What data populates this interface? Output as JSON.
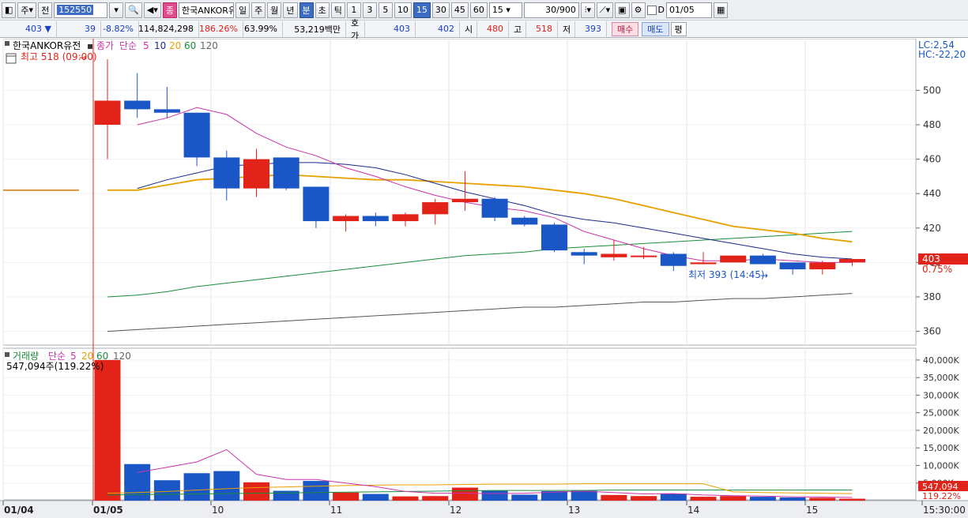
{
  "toolbar": {
    "period_select": "주",
    "prev_label": "전",
    "stock_code": "152550",
    "pink_label": "종",
    "stock_name": "한국ANKOR유",
    "period_buttons": [
      "일",
      "주",
      "월",
      "년"
    ],
    "selected_period": "분",
    "tick_labels": [
      "초",
      "틱"
    ],
    "interval_buttons": [
      "1",
      "3",
      "5",
      "10",
      "15",
      "30",
      "45",
      "60"
    ],
    "selected_interval": "15",
    "interval_select": "15",
    "count_value": "30/900",
    "checkbox_label": "D",
    "date_value": "01/05"
  },
  "quote": {
    "price": "403",
    "direction": "▼",
    "change": "39",
    "change_pct": "-8.82%",
    "volume": "114,824,298",
    "volume_ratio": "186.26%",
    "turnover": "63.99%",
    "amount": "53,219백만",
    "hoga_label": "호가",
    "ask": "403",
    "bid": "402",
    "open_label": "시",
    "open": "480",
    "high_label": "고",
    "high": "518",
    "low_label": "저",
    "low": "393",
    "buy_label": "매수",
    "sell_label": "매도",
    "eval_label": "평"
  },
  "price_panel": {
    "name": "한국ANKOR유전",
    "close_label": "종가",
    "ma_label": "단순",
    "ma_periods": [
      "5",
      "10",
      "20",
      "60",
      "120"
    ],
    "high_annot": "최고 518 (09:00)",
    "low_annot": "최저 393 (14:45)",
    "lc": "LC:2,54",
    "hc": "HC:-22,20",
    "current_price": "403",
    "current_pct": "0.75%"
  },
  "volume_panel": {
    "title": "거래량",
    "ma_label": "단순",
    "ma_periods": [
      "5",
      "20",
      "60",
      "120"
    ],
    "info": "547,094주(119.22%)",
    "current_volume": "547,094",
    "current_pct": "119.22%"
  },
  "colors": {
    "up": "#e2231a",
    "down": "#1b56c6",
    "ma5": "#cc33aa",
    "ma10": "#1a2a8c",
    "ma20": "#e8a000",
    "ma60": "#1a8c3a",
    "ma120": "#555555"
  },
  "chart_data": [
    {
      "type": "candlestick",
      "x_axis_labels": [
        "01/04",
        "01/05",
        "10",
        "11",
        "12",
        "13",
        "14",
        "15",
        "15:30:00"
      ],
      "y_ticks": [
        500,
        480,
        460,
        440,
        420,
        400,
        380,
        360
      ],
      "ylim": [
        352,
        530
      ],
      "prev_close": 442,
      "candles": [
        {
          "o": 480,
          "h": 518,
          "l": 460,
          "c": 494
        },
        {
          "o": 494,
          "h": 510,
          "l": 484,
          "c": 489
        },
        {
          "o": 489,
          "h": 502,
          "l": 484,
          "c": 487
        },
        {
          "o": 487,
          "h": 487,
          "l": 456,
          "c": 461
        },
        {
          "o": 461,
          "h": 465,
          "l": 436,
          "c": 443
        },
        {
          "o": 443,
          "h": 466,
          "l": 438,
          "c": 460
        },
        {
          "o": 461,
          "h": 461,
          "l": 442,
          "c": 443
        },
        {
          "o": 444,
          "h": 444,
          "l": 420,
          "c": 424
        },
        {
          "o": 424,
          "h": 428,
          "l": 418,
          "c": 427
        },
        {
          "o": 427,
          "h": 429,
          "l": 421,
          "c": 424
        },
        {
          "o": 424,
          "h": 429,
          "l": 421,
          "c": 428
        },
        {
          "o": 428,
          "h": 437,
          "l": 422,
          "c": 435
        },
        {
          "o": 435,
          "h": 453,
          "l": 430,
          "c": 437
        },
        {
          "o": 437,
          "h": 438,
          "l": 424,
          "c": 426
        },
        {
          "o": 426,
          "h": 427,
          "l": 421,
          "c": 422
        },
        {
          "o": 422,
          "h": 423,
          "l": 406,
          "c": 407
        },
        {
          "o": 406,
          "h": 408,
          "l": 399,
          "c": 404
        },
        {
          "o": 403,
          "h": 413,
          "l": 401,
          "c": 405
        },
        {
          "o": 404,
          "h": 409,
          "l": 402,
          "c": 404
        },
        {
          "o": 405,
          "h": 406,
          "l": 395,
          "c": 398
        },
        {
          "o": 399,
          "h": 406,
          "l": 399,
          "c": 400
        },
        {
          "o": 400,
          "h": 404,
          "l": 400,
          "c": 404
        },
        {
          "o": 404,
          "h": 405,
          "l": 399,
          "c": 399
        },
        {
          "o": 400,
          "h": 400,
          "l": 393,
          "c": 396
        },
        {
          "o": 396,
          "h": 401,
          "l": 393,
          "c": 400
        },
        {
          "o": 400,
          "h": 401,
          "l": 398,
          "c": 402
        }
      ],
      "ma5": [
        null,
        480,
        484,
        490,
        486,
        475,
        467,
        462,
        455,
        450,
        444,
        439,
        435,
        432,
        430,
        426,
        418,
        413,
        408,
        404,
        401,
        401,
        402,
        401,
        400,
        400
      ],
      "ma10": [
        null,
        443,
        448,
        452,
        456,
        457,
        458,
        458,
        457,
        455,
        451,
        446,
        441,
        437,
        433,
        428,
        425,
        423,
        420,
        417,
        414,
        411,
        408,
        405,
        403,
        402
      ],
      "ma20": [
        442,
        442,
        445,
        448,
        449,
        450,
        451,
        450,
        449,
        448,
        448,
        447,
        446,
        445,
        444,
        442,
        440,
        437,
        433,
        429,
        425,
        421,
        419,
        417,
        414,
        412
      ],
      "ma60": [
        380,
        381,
        383,
        386,
        388,
        390,
        392,
        394,
        396,
        398,
        400,
        402,
        404,
        405,
        406,
        408,
        409,
        410,
        411,
        412,
        413,
        414,
        415,
        416,
        417,
        418
      ],
      "ma120": [
        360,
        361,
        362,
        363,
        364,
        365,
        366,
        367,
        368,
        369,
        370,
        371,
        372,
        373,
        374,
        374,
        375,
        376,
        377,
        377,
        378,
        379,
        379,
        380,
        381,
        382
      ]
    },
    {
      "type": "bar",
      "title": "거래량",
      "y_ticks": [
        "40,000K",
        "35,000K",
        "30,000K",
        "25,000K",
        "20,000K",
        "15,000K",
        "10,000K",
        "5,000K"
      ],
      "ylim": [
        0,
        42000
      ],
      "values": [
        40000,
        10400,
        5800,
        7800,
        8400,
        5200,
        2800,
        5600,
        2300,
        1900,
        1200,
        1300,
        3700,
        2800,
        1700,
        2700,
        2800,
        1600,
        1300,
        2000,
        1100,
        1300,
        1100,
        900,
        800,
        547
      ],
      "ma5": [
        null,
        8000,
        9500,
        11000,
        14500,
        7500,
        6000,
        6000,
        5000,
        4000,
        2600,
        2100,
        2100,
        2000,
        2100,
        2400,
        2700,
        2300,
        1900,
        2000,
        1600,
        1400,
        1300,
        1100,
        1000,
        900
      ],
      "ma20": [
        2100,
        2300,
        2600,
        3000,
        3400,
        3700,
        3900,
        4100,
        4300,
        4400,
        4500,
        4500,
        4600,
        4700,
        4700,
        4700,
        4800,
        4800,
        4800,
        4800,
        4800,
        2500,
        2300,
        2200,
        2100,
        2000
      ],
      "ma60": [
        1600,
        1700,
        1800,
        1900,
        2000,
        2100,
        2200,
        2300,
        2400,
        2500,
        2600,
        2700,
        2800,
        2900,
        2900,
        2900,
        2900,
        3000,
        3000,
        3000,
        3000,
        3000,
        3000,
        3000,
        3000,
        3000
      ]
    }
  ]
}
